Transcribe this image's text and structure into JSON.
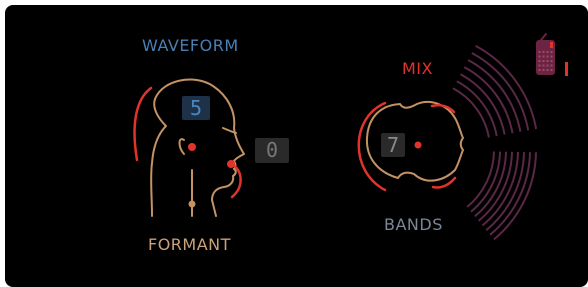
{
  "labels": {
    "waveform": "WAVEFORM",
    "formant": "FORMANT",
    "mix": "MIX",
    "bands": "BANDS"
  },
  "values": {
    "waveform": "5",
    "formant": "0",
    "bands": "7"
  },
  "colors": {
    "background": "#000000",
    "waveform": "#4a7fb4",
    "formant": "#c9a27a",
    "mix": "#e0332c",
    "bands": "#7b8797",
    "arcs": "#5a2845"
  },
  "icons": {
    "head_profile": "head-profile-icon",
    "head_top": "head-top-icon",
    "device": "radio-device-icon"
  }
}
